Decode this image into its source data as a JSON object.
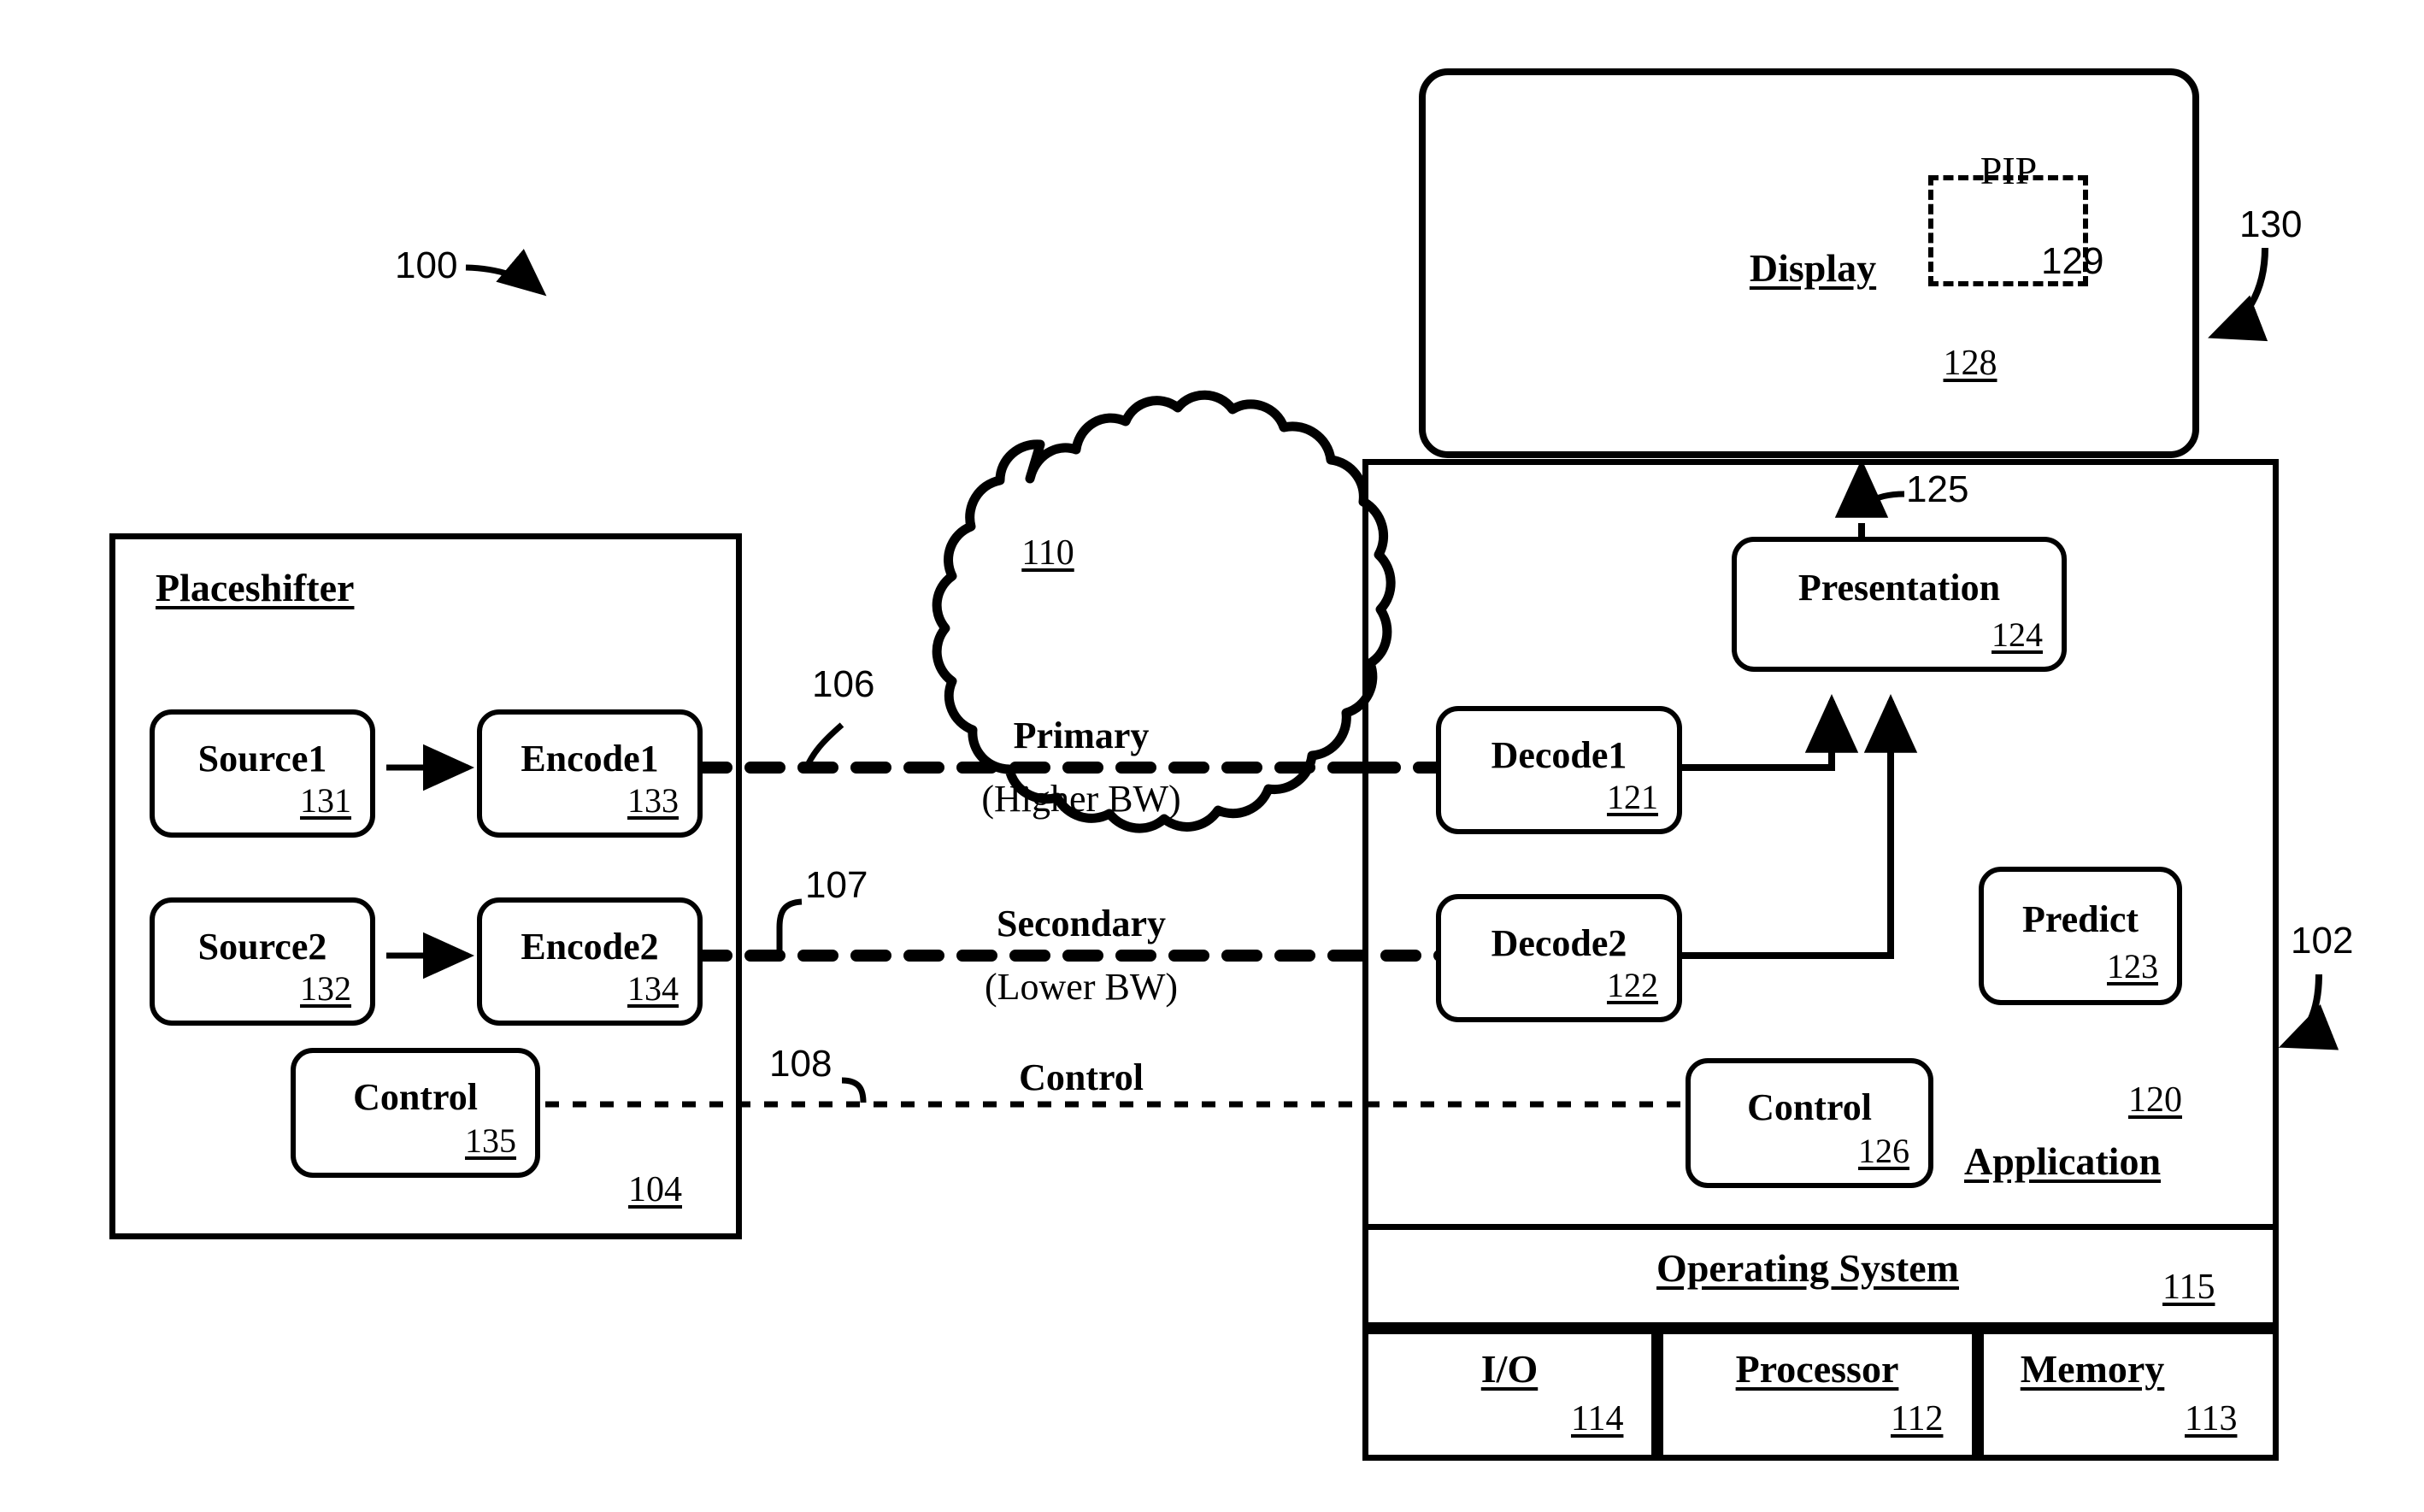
{
  "figure": {
    "ref_100": "100",
    "ref_102": "102",
    "ref_130": "130"
  },
  "placeshifter": {
    "title": "Placeshifter",
    "ref": "104",
    "nodes": [
      {
        "label": "Source1",
        "ref": "131"
      },
      {
        "label": "Encode1",
        "ref": "133"
      },
      {
        "label": "Source2",
        "ref": "132"
      },
      {
        "label": "Encode2",
        "ref": "134"
      },
      {
        "label": "Control",
        "ref": "135"
      }
    ]
  },
  "network": {
    "ref": "110",
    "channels": [
      {
        "name": "Primary",
        "detail": "(Higher BW)",
        "ref": "106"
      },
      {
        "name": "Secondary",
        "detail": "(Lower BW)",
        "ref": "107"
      },
      {
        "name": "Control",
        "detail": "",
        "ref": "108"
      }
    ]
  },
  "display": {
    "title": "Display",
    "ref": "128",
    "pip": {
      "label": "PIP",
      "ref": "129"
    }
  },
  "client": {
    "application": {
      "title": "Application",
      "ref": "120"
    },
    "nodes": [
      {
        "label": "Decode1",
        "ref": "121"
      },
      {
        "label": "Decode2",
        "ref": "122"
      },
      {
        "label": "Predict",
        "ref": "123"
      },
      {
        "label": "Presentation",
        "ref": "124"
      },
      {
        "label": "Control",
        "ref": "126"
      }
    ],
    "presentation_link_ref": "125",
    "operating_system": {
      "title": "Operating System",
      "ref": "115"
    },
    "hardware": [
      {
        "title": "I/O",
        "ref": "114"
      },
      {
        "title": "Processor",
        "ref": "112"
      },
      {
        "title": "Memory",
        "ref": "113"
      }
    ]
  }
}
